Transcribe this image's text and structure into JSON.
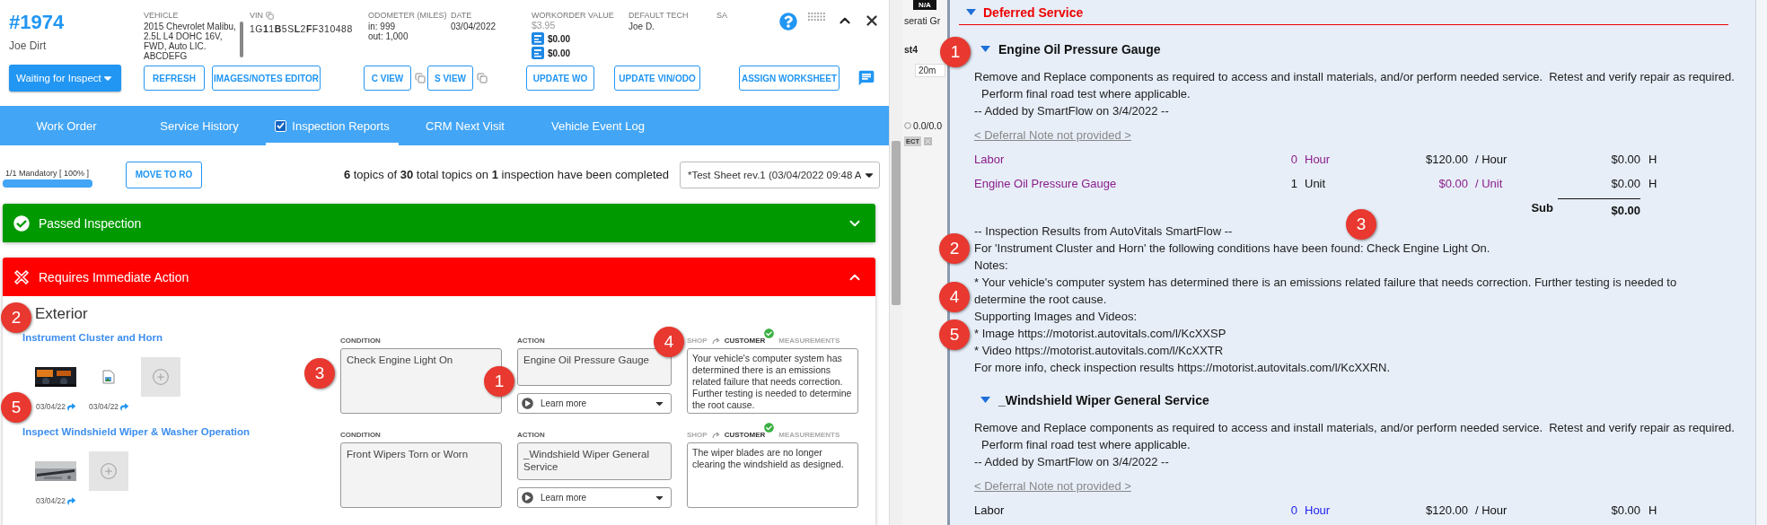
{
  "header": {
    "number": "#1974",
    "customer": "Joe Dirt",
    "fields": [
      {
        "kind": "lines",
        "label": "VEHICLE",
        "lines": [
          "2015 Chevrolet Malibu,",
          "2.5L L4 DOHC 16V,",
          "FWD, Auto LIC.",
          "ABCDEFG"
        ]
      },
      {
        "kind": "vin",
        "label": "VIN",
        "value": "1G**1**1**B**5S**L**2**F**F310488"
      },
      {
        "kind": "lines",
        "label": "ODOMETER (MILES)",
        "lines": [
          "in: 999",
          "out: 1,000"
        ]
      },
      {
        "kind": "lines",
        "label": "DATE",
        "lines": [
          "03/04/2022"
        ]
      },
      {
        "kind": "value",
        "label": "WORKORDER VALUE",
        "total": "$3.95",
        "amounts": [
          "$0.00",
          "$0.00"
        ]
      },
      {
        "kind": "lines",
        "label": "DEFAULT TECH",
        "lines": [
          "Joe D."
        ]
      },
      {
        "kind": "lines",
        "label": "SA"
      }
    ]
  },
  "actions": [
    {
      "kind": "status",
      "label": "Waiting for Inspect"
    },
    {
      "kind": "button",
      "label": "REFRESH"
    },
    {
      "kind": "button",
      "label": "IMAGES/NOTES EDITOR"
    },
    {
      "kind": "copy",
      "label": "C VIEW"
    },
    {
      "kind": "copy",
      "label": "S VIEW"
    },
    {
      "kind": "button",
      "label": "UPDATE WO"
    },
    {
      "kind": "button",
      "label": "UPDATE VIN/ODO"
    },
    {
      "kind": "button",
      "label": "ASSIGN WORKSHEET"
    }
  ],
  "tabs": [
    {
      "kind": "plain",
      "label": "Work Order",
      "selected": false
    },
    {
      "kind": "plain",
      "label": "Service History",
      "selected": false
    },
    {
      "kind": "checkbox",
      "label": "Inspection Reports",
      "selected": true,
      "checked": true
    },
    {
      "kind": "plain",
      "label": "CRM Next Visit",
      "selected": false
    },
    {
      "kind": "plain",
      "label": "Vehicle Event Log",
      "selected": false
    }
  ],
  "progress": {
    "label": "1/1 Mandatory [ 100% ]",
    "level": 1
  },
  "move_button": "MOVE TO RO",
  "summary": "**6** topics of **30** total topics on **1** inspection have been completed",
  "sheet_select": {
    "value": "*Test Sheet rev.1 (03/04/2022 09:48 A"
  },
  "sections": [
    {
      "kind": "passed",
      "title": "Passed Inspection",
      "expanded": false,
      "color": "#009a00"
    },
    {
      "kind": "failed",
      "title": "Requires Immediate Action",
      "expanded": true,
      "color": "#ff0000",
      "groups": [
        {
          "title": "Exterior",
          "items": [
            {
              "title": "Instrument Cluster and Horn",
              "media": [
                {
                  "date": "03/04/22"
                },
                {
                  "kind": "broken",
                  "date": "03/04/22"
                },
                {
                  "kind": "add"
                }
              ],
              "condition_label": "CONDITION",
              "condition": "Check Engine Light On",
              "action_label": "ACTION",
              "action": "Engine Oil Pressure Gauge",
              "learn_more": "Learn more",
              "note_tabs": [
                {
                  "label": "SHOP",
                  "selected": false
                },
                {
                  "label": "CUSTOMER",
                  "selected": true
                },
                {
                  "label": "MEASUREMENTS",
                  "selected": false
                }
              ],
              "note": "Your vehicle's computer system has determined there is an emissions related failure that needs correction. Further testing is needed to determine the root cause."
            },
            {
              "title": "Inspect Windshield Wiper & Washer Operation",
              "media": [
                {
                  "date": "03/04/22"
                },
                {
                  "kind": "add"
                }
              ],
              "condition_label": "CONDITION",
              "condition": "Front Wipers Torn or Worn",
              "action_label": "ACTION",
              "action": "_Windshield Wiper General Service",
              "learn_more": "Learn more",
              "note_tabs": [
                {
                  "label": "SHOP",
                  "selected": false
                },
                {
                  "label": "CUSTOMER",
                  "selected": true
                },
                {
                  "label": "MEASUREMENTS",
                  "selected": false
                }
              ],
              "note": "The wiper blades are no longer clearing the windshield as designed."
            }
          ]
        }
      ]
    }
  ],
  "background_app": {
    "badge": "N/A",
    "vehicle": "serati Gr",
    "label": "st4",
    "time": "20m",
    "rating": "0.0/0.0",
    "tag": "ECT"
  },
  "deferred": {
    "title": "Deferred Service",
    "expanded": true,
    "services": [
      {
        "title": "Engine Oil Pressure Gauge",
        "expanded": true,
        "description": [
          "Remove and Replace components as required to access and install materials, and/or perform needed service.  Retest and verify repair as required.",
          "Perform final road test where applicable."
        ],
        "added": "-- Added by SmartFlow on 3/4/2022 --",
        "deferral_note": "< Deferral Note not provided >",
        "lines": [
          {
            "name": "Labor",
            "qty": "0",
            "unit": "Hour",
            "rate": "$120.00",
            "per": "/ Hour",
            "total": "$0.00",
            "flag": "H",
            "visited": true,
            "name_link": true,
            "qty_link": true,
            "rate_link": false
          },
          {
            "name": "Engine Oil Pressure Gauge",
            "qty": "1",
            "unit": "Unit",
            "rate": "$0.00",
            "per": "/ Unit",
            "total": "$0.00",
            "flag": "H",
            "visited": true,
            "name_link": true,
            "qty_link": false,
            "rate_link": true
          }
        ],
        "subtotal": {
          "label": "Sub",
          "value": "$0.00"
        },
        "results": [
          "-- Inspection Results from AutoVitals SmartFlow --",
          "For 'Instrument Cluster and Horn' the following conditions have been found: Check Engine Light On.",
          "Notes:",
          "* Your vehicle's computer system has determined there is an emissions related failure that needs correction. Further testing is needed to determine the root cause.",
          "Supporting Images and Videos:",
          "* Image https://motorist.autovitals.com/l/KcXXSP",
          "* Video https://motorist.autovitals.com/l/KcXXTR",
          "For more info, check inspection results https://motorist.autovitals.com/l/KcXXRN."
        ]
      },
      {
        "title": "_Windshield Wiper General Service",
        "expanded": true,
        "description": [
          "Remove and Replace components as required to access and install materials, and/or perform needed service.  Retest and verify repair as required.",
          "Perform final road test where applicable."
        ],
        "added": "-- Added by SmartFlow on 3/4/2022 --",
        "deferral_note": "< Deferral Note not provided >",
        "lines": [
          {
            "name": "Labor",
            "qty": "0",
            "unit": "Hour",
            "rate": "$120.00",
            "per": "/ Hour",
            "total": "$0.00",
            "flag": "H",
            "visited": false,
            "name_link": false,
            "qty_link": true,
            "rate_link": false
          }
        ]
      }
    ]
  },
  "callouts": [
    {
      "number": "2"
    },
    {
      "number": "5"
    },
    {
      "number": "3"
    },
    {
      "number": "1"
    },
    {
      "number": "4"
    },
    {
      "number": "1"
    },
    {
      "number": "3"
    },
    {
      "number": "2"
    },
    {
      "number": "4"
    },
    {
      "number": "5"
    }
  ]
}
